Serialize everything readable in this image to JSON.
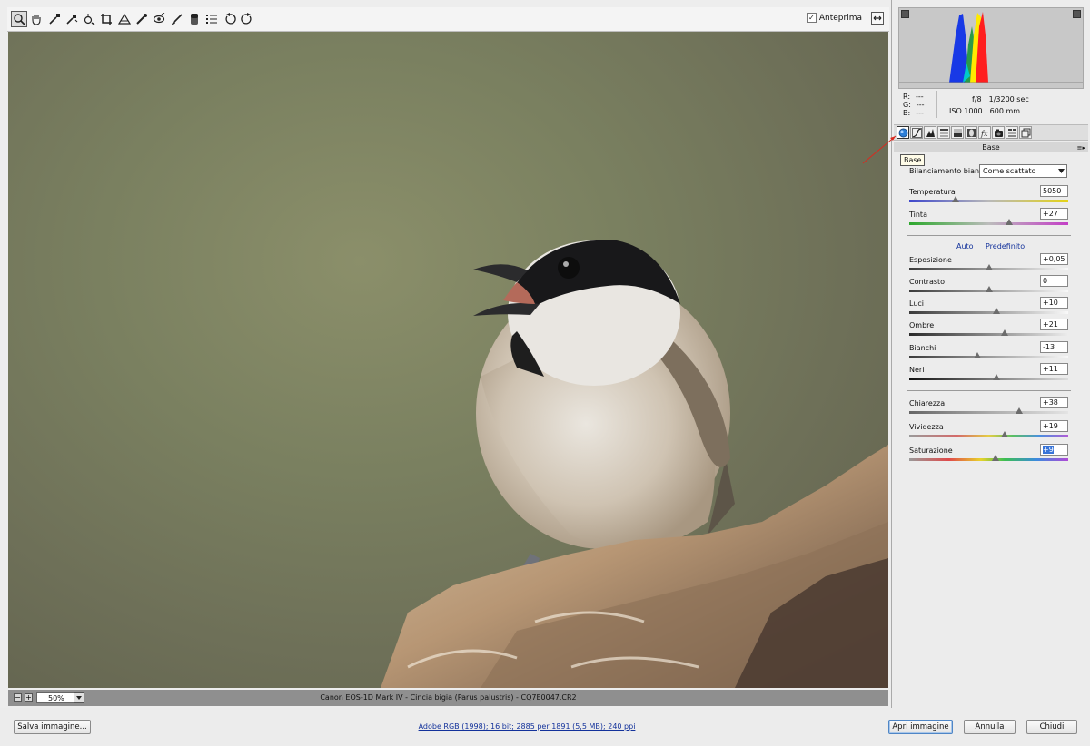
{
  "toolbar": {
    "tools": [
      {
        "name": "zoom-tool-icon",
        "active": true
      },
      {
        "name": "hand-tool-icon"
      },
      {
        "name": "white-balance-tool-icon"
      },
      {
        "name": "color-sampler-tool-icon"
      },
      {
        "name": "targeted-adjustment-tool-icon"
      },
      {
        "name": "crop-tool-icon"
      },
      {
        "name": "straighten-tool-icon"
      },
      {
        "name": "spot-removal-tool-icon"
      },
      {
        "name": "red-eye-removal-tool-icon"
      },
      {
        "name": "adjustment-brush-icon"
      },
      {
        "name": "graduated-filter-icon"
      },
      {
        "name": "preferences-icon"
      },
      {
        "name": "rotate-left-icon"
      },
      {
        "name": "rotate-right-icon"
      }
    ],
    "preview_label": "Anteprima",
    "preview_checked": true
  },
  "statusbar": {
    "zoom_out": "−",
    "zoom_in": "+",
    "zoom_value": "50%",
    "caption": "Canon EOS-1D Mark IV  -  Cincia bigia (Parus palustris)  -  CQ7E0047.CR2"
  },
  "panel": {
    "readouts": {
      "r_label": "R:",
      "r_value": "---",
      "g_label": "G:",
      "g_value": "---",
      "b_label": "B:",
      "b_value": "---"
    },
    "exif": {
      "aperture": "f/8",
      "shutter": "1/3200 sec",
      "iso": "ISO 1000",
      "focal": "600 mm"
    },
    "section_title": "Base",
    "tooltip": "Base",
    "white_balance_label": "Bilanciamento bianco:",
    "white_balance_value": "Come scattato",
    "auto_label": "Auto",
    "default_label": "Predefinito",
    "sliders": {
      "temperatura": {
        "label": "Temperatura",
        "value": "5050",
        "position": 0.29
      },
      "tinta": {
        "label": "Tinta",
        "value": "+27",
        "position": 0.63
      },
      "esposizione": {
        "label": "Esposizione",
        "value": "+0,05",
        "position": 0.5
      },
      "contrasto": {
        "label": "Contrasto",
        "value": "0",
        "position": 0.5
      },
      "luci": {
        "label": "Luci",
        "value": "+10",
        "position": 0.55
      },
      "ombre": {
        "label": "Ombre",
        "value": "+21",
        "position": 0.6
      },
      "bianchi": {
        "label": "Bianchi",
        "value": "-13",
        "position": 0.43
      },
      "neri": {
        "label": "Neri",
        "value": "+11",
        "position": 0.55
      },
      "chiarezza": {
        "label": "Chiarezza",
        "value": "+38",
        "position": 0.69
      },
      "vividezza": {
        "label": "Vividezza",
        "value": "+19",
        "position": 0.6
      },
      "saturazione": {
        "label": "Saturazione",
        "value": "+9",
        "position": 0.54
      }
    }
  },
  "footer": {
    "save_label": "Salva immagine...",
    "workflow_label": "Adobe RGB (1998); 16 bit; 2885 per 1891 (5,5 MB); 240 ppi",
    "open_label": "Apri immagine",
    "cancel_label": "Annulla",
    "close_label": "Chiudi"
  },
  "colors": {
    "accent": "#4f86c6",
    "link": "#13329b",
    "selection": "#3874d8"
  }
}
